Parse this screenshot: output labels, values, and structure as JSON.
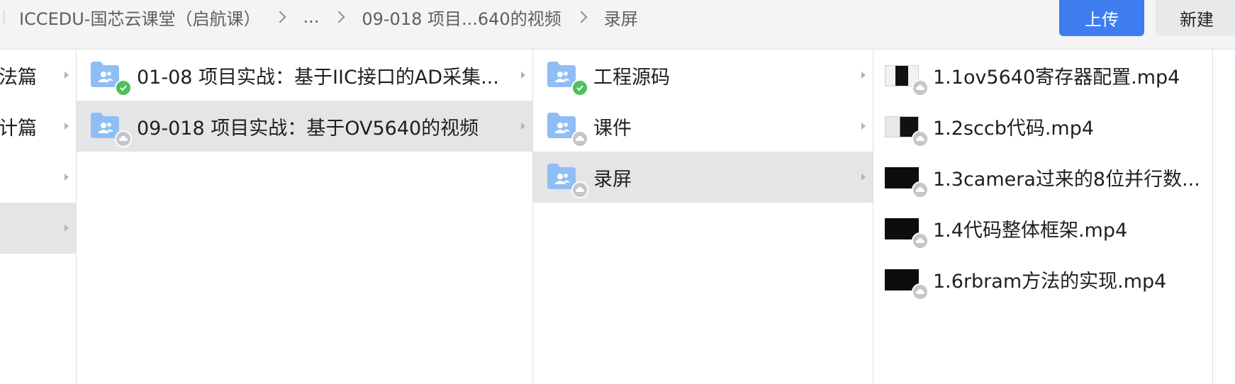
{
  "breadcrumb": {
    "items": [
      "ICCEDU-国芯云课堂（启航课）",
      "...",
      "09-018 项目...640的视频",
      "录屏"
    ]
  },
  "toolbar": {
    "upload_label": "上传",
    "new_label": "新建"
  },
  "columns": {
    "col1": {
      "items": [
        {
          "label": "法篇"
        },
        {
          "label": "计篇"
        },
        {
          "label": ""
        },
        {
          "label": ""
        }
      ]
    },
    "col2": {
      "items": [
        {
          "label": "01-08 项目实战：基于IIC接口的AD采集...",
          "sync": "synced"
        },
        {
          "label": "09-018 项目实战：基于OV5640的视频",
          "sync": "cloud",
          "selected": true
        }
      ]
    },
    "col3": {
      "items": [
        {
          "label": "工程源码",
          "sync": "synced"
        },
        {
          "label": "课件",
          "sync": "cloud"
        },
        {
          "label": "录屏",
          "sync": "cloud",
          "selected": true
        }
      ]
    },
    "col4": {
      "items": [
        {
          "label": "1.1ov5640寄存器配置.mp4"
        },
        {
          "label": "1.2sccb代码.mp4"
        },
        {
          "label": "1.3camera过来的8位并行数..."
        },
        {
          "label": "1.4代码整体框架.mp4"
        },
        {
          "label": "1.6rbram方法的实现.mp4"
        }
      ]
    }
  },
  "colors": {
    "accent": "#3e7cf0",
    "synced": "#4cc15a",
    "cloud": "#c6c6ca",
    "folder": "#8fbef4"
  },
  "icons": {
    "folder": "shared-folder-icon",
    "synced": "check-badge-icon",
    "cloud": "cloud-badge-icon",
    "video": "video-thumbnail-icon"
  }
}
